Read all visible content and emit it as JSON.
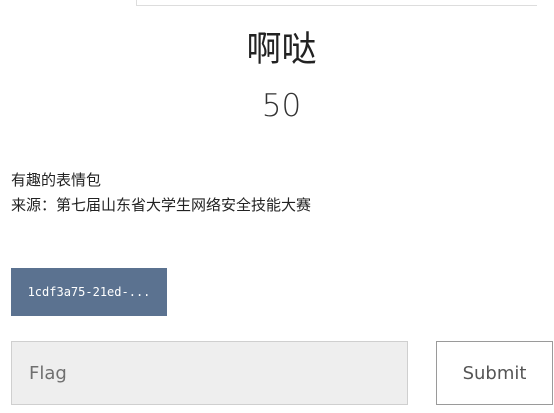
{
  "challenge": {
    "name": "啊哒",
    "value": "50"
  },
  "description": {
    "line1": "有趣的表情包",
    "line2": "来源：第七届山东省大学生网络安全技能大赛"
  },
  "attachment": {
    "label": "1cdf3a75-21ed-..."
  },
  "flag_form": {
    "placeholder": "Flag",
    "value": "",
    "submit_label": "Submit"
  },
  "colors": {
    "attachment_bg": "#5b7290",
    "input_bg": "#eeeeee"
  }
}
